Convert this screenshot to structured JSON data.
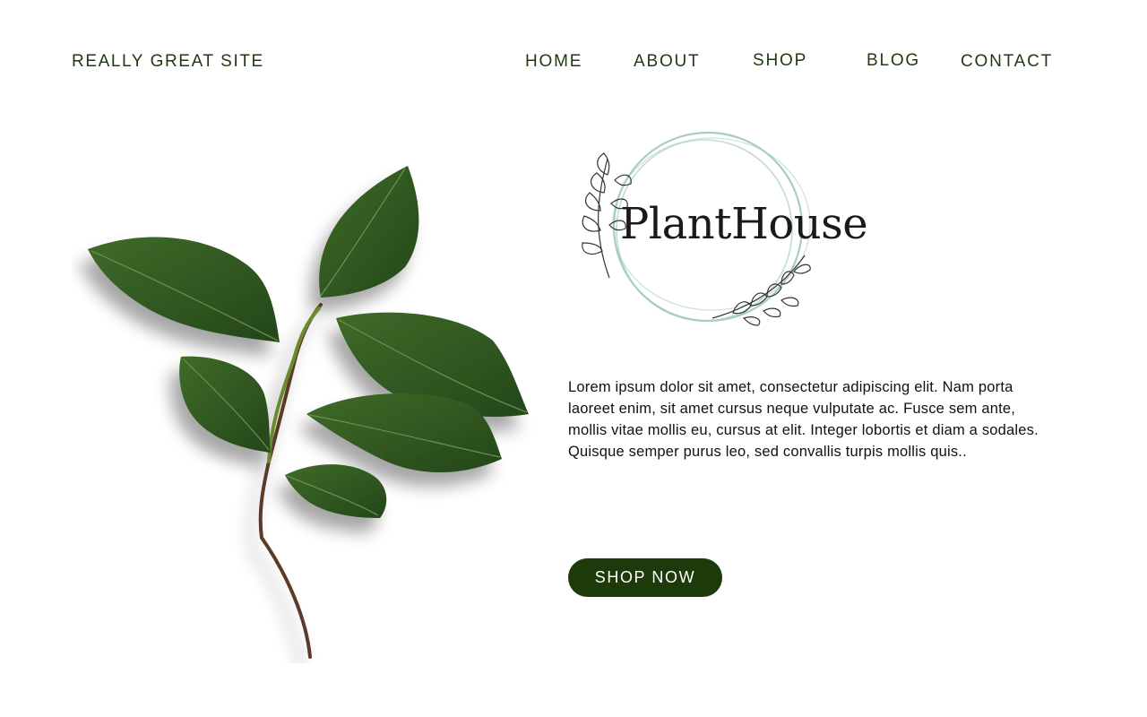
{
  "header": {
    "site_name": "REALLY GREAT SITE",
    "nav": [
      "HOME",
      "ABOUT",
      "SHOP",
      "BLOG",
      "CONTACT"
    ]
  },
  "hero": {
    "logo_text": "PlantHouse",
    "description": "Lorem ipsum dolor sit amet, consectetur adipiscing elit. Nam porta laoreet enim, sit amet cursus neque vulputate ac. Fusce sem ante, mollis vitae mollis eu, cursus at elit. Integer lobortis et diam a sodales. Quisque semper purus leo, sed convallis turpis mollis quis..",
    "cta_label": "SHOP NOW"
  },
  "icons": {
    "plant": "leafy-branch-illustration",
    "logo_wreath": "circle-wreath-logo"
  },
  "colors": {
    "brand_dark_green": "#1f3a0a",
    "leaf_green": "#2f5a1c",
    "wreath_mint": "#9ec9b5"
  }
}
